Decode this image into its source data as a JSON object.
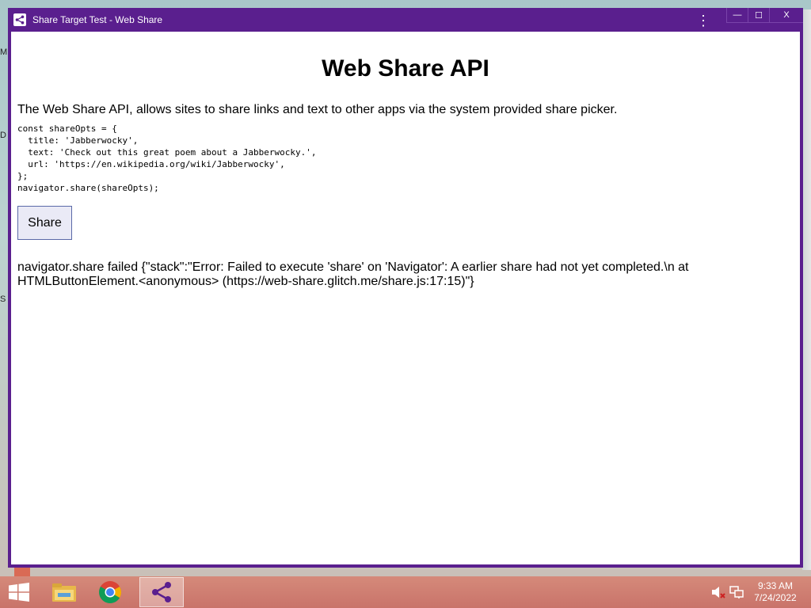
{
  "window": {
    "title": "Share Target Test - Web Share",
    "controls": {
      "menu": "⋮",
      "minimize": "—",
      "maximize": "☐",
      "close": "X"
    }
  },
  "page": {
    "heading": "Web Share API",
    "description": "The Web Share API, allows sites to share links and text to other apps via the system provided share picker.",
    "code": "const shareOpts = {\n  title: 'Jabberwocky',\n  text: 'Check out this great poem about a Jabberwocky.',\n  url: 'https://en.wikipedia.org/wiki/Jabberwocky',\n};\nnavigator.share(shareOpts);",
    "share_button": "Share",
    "error_text": "navigator.share failed {\"stack\":\"Error: Failed to execute 'share' on 'Navigator': A earlier share had not yet completed.\\n at HTMLButtonElement.<anonymous> (https://web-share.glitch.me/share.js:17:15)\"}"
  },
  "desktop": {
    "left_fragments": [
      "M",
      "D",
      "S"
    ]
  },
  "taskbar": {
    "items": [
      "file-explorer-icon",
      "chrome-icon",
      "share-app-icon"
    ],
    "clock": {
      "time": "9:33 AM",
      "date": "7/24/2022"
    }
  },
  "colors": {
    "titlebar": "#5a1f8e",
    "taskbar": "#cf7f70",
    "button_border": "#5b6aa8"
  }
}
